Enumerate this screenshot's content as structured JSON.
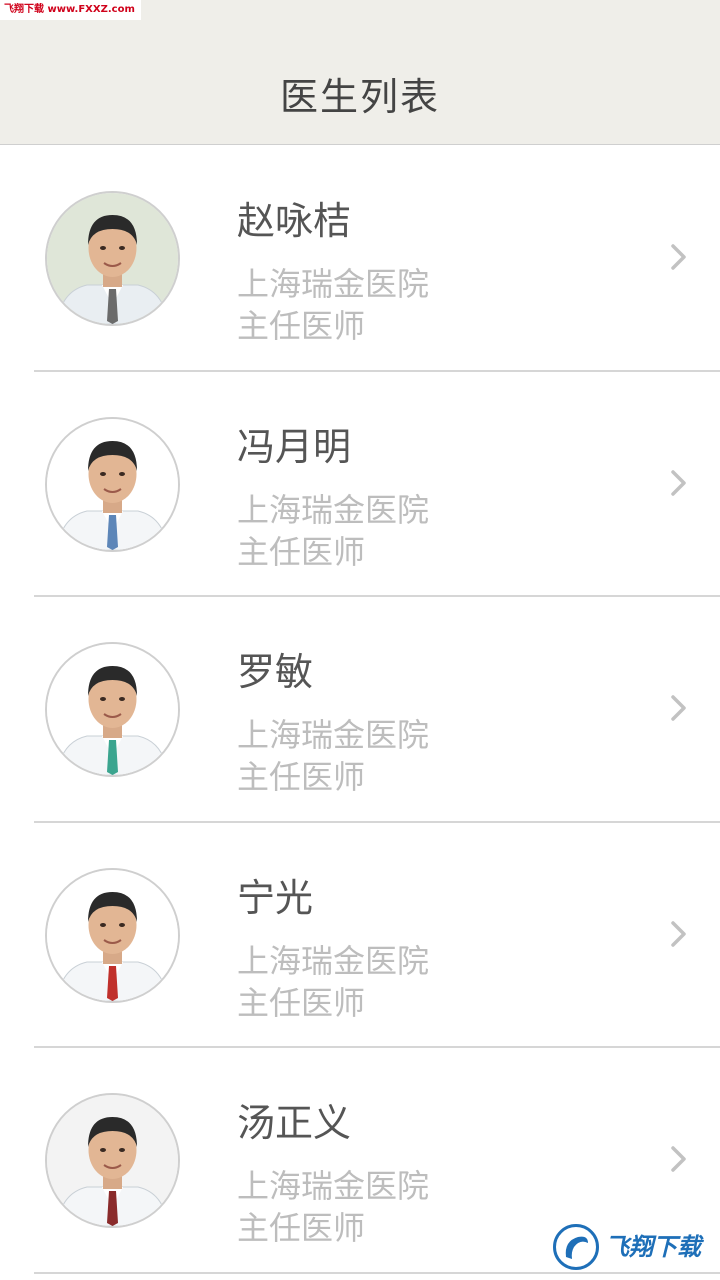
{
  "watermark": {
    "top_text": "飞翔下载 www.FXXZ.com",
    "bottom_text": "飞翔下载",
    "bottom_logo_icon": "fxxz-logo-icon"
  },
  "header": {
    "title": "医生列表"
  },
  "doctors": [
    {
      "name": "赵咏桔",
      "hospital": "上海瑞金医院",
      "title": "主任医师",
      "avatar_icon": "doctor-avatar-icon",
      "tie_color": "#6b6b6b",
      "coat_color": "#e9eef2",
      "bg_color": "#dfe6d8"
    },
    {
      "name": "冯月明",
      "hospital": "上海瑞金医院",
      "title": "主任医师",
      "avatar_icon": "doctor-avatar-icon",
      "tie_color": "#5d86b8",
      "coat_color": "#f4f6f8",
      "bg_color": "#ffffff"
    },
    {
      "name": "罗敏",
      "hospital": "上海瑞金医院",
      "title": "主任医师",
      "avatar_icon": "doctor-avatar-icon",
      "tie_color": "#3ba58f",
      "coat_color": "#f4f6f8",
      "bg_color": "#ffffff"
    },
    {
      "name": "宁光",
      "hospital": "上海瑞金医院",
      "title": "主任医师",
      "avatar_icon": "doctor-avatar-icon",
      "tie_color": "#c0302b",
      "coat_color": "#f4f6f8",
      "bg_color": "#ffffff"
    },
    {
      "name": "汤正义",
      "hospital": "上海瑞金医院",
      "title": "主任医师",
      "avatar_icon": "doctor-avatar-icon",
      "tie_color": "#8a2b2b",
      "coat_color": "#f4f6f8",
      "bg_color": "#f3f3f3"
    }
  ],
  "row_chevron_icon": "chevron-right-icon"
}
